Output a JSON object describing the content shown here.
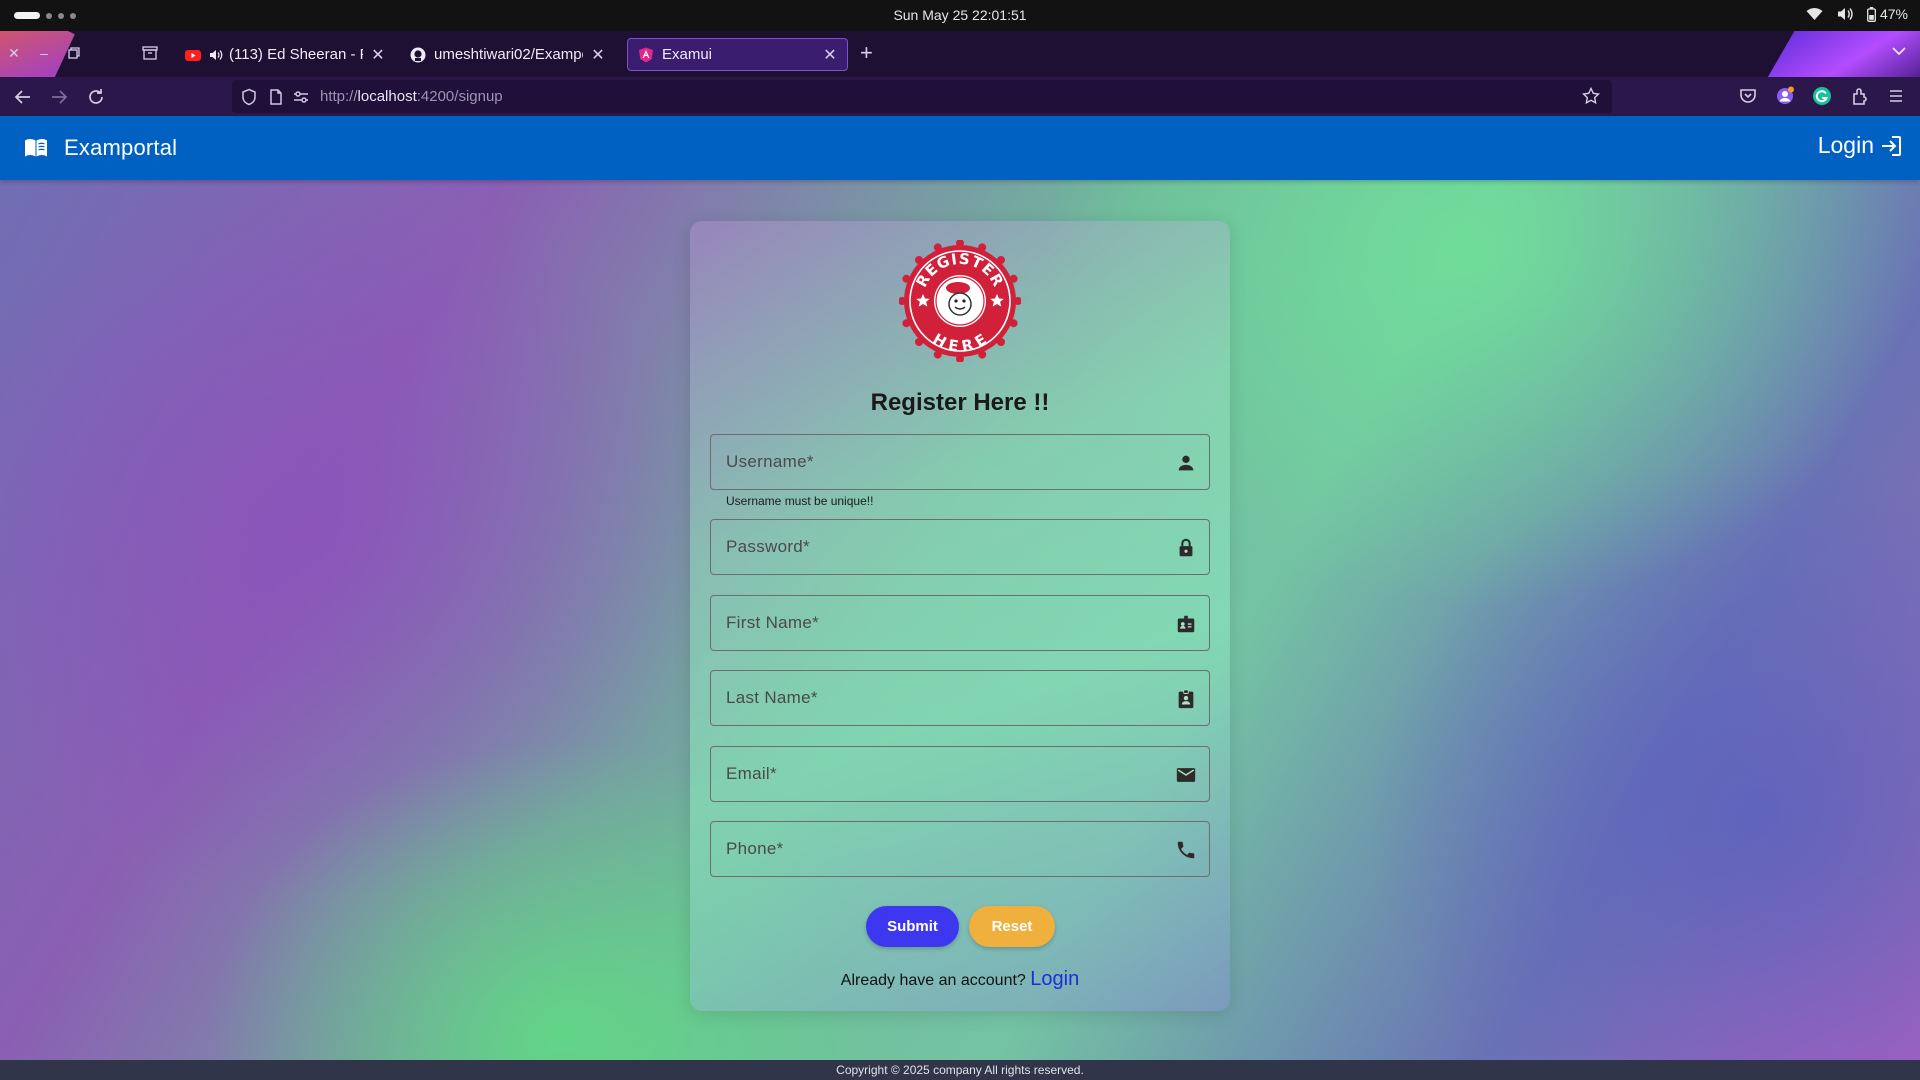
{
  "system": {
    "clock": "Sun May 25  22:01:51",
    "battery": "47%"
  },
  "browser": {
    "tabs": [
      {
        "title": "(113) Ed Sheeran - Per",
        "icon": "youtube-icon",
        "audio": true
      },
      {
        "title": "umeshtiwari02/Examport",
        "icon": "github-icon"
      },
      {
        "title": "Examui",
        "icon": "angular-icon",
        "active": true
      }
    ],
    "url_prefix": "http://",
    "url_host": "localhost",
    "url_path": ":4200/signup"
  },
  "app": {
    "brand": "Examportal",
    "login_label": "Login",
    "title": "Register Here !!",
    "badge_top": "REGISTER",
    "badge_bottom": "HERE",
    "fields": {
      "username": {
        "placeholder": "Username*",
        "icon": "person-icon"
      },
      "password": {
        "placeholder": "Password*",
        "icon": "lock-icon"
      },
      "first_name": {
        "placeholder": "First Name*",
        "icon": "id-card-icon"
      },
      "last_name": {
        "placeholder": "Last Name*",
        "icon": "badge-icon"
      },
      "email": {
        "placeholder": "Email*",
        "icon": "mail-icon"
      },
      "phone": {
        "placeholder": "Phone*",
        "icon": "phone-icon"
      }
    },
    "username_hint": "Username must be unique!!",
    "submit_label": "Submit",
    "reset_label": "Reset",
    "already_text": "Already have an account?",
    "already_link": "Login",
    "footer": "Copyright © 2025 company All rights reserved."
  },
  "colors": {
    "appbar": "#0061c2",
    "submit": "#3d38f0",
    "reset": "#f0b03e",
    "badge": "#d0203a"
  }
}
